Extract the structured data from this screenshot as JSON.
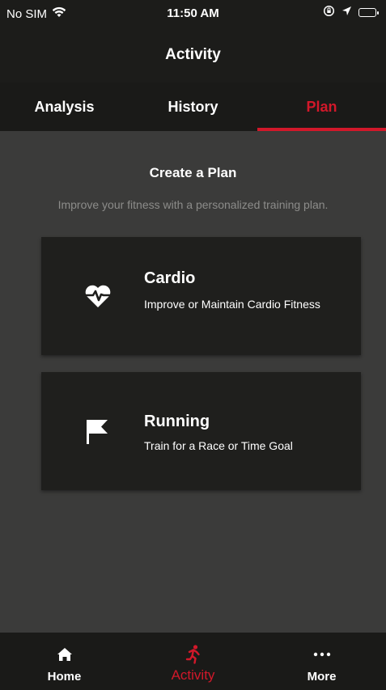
{
  "status_bar": {
    "carrier": "No SIM",
    "time": "11:50 AM"
  },
  "header": {
    "title": "Activity"
  },
  "tabs": [
    {
      "label": "Analysis",
      "active": false
    },
    {
      "label": "History",
      "active": false
    },
    {
      "label": "Plan",
      "active": true
    }
  ],
  "content": {
    "title": "Create a Plan",
    "subtitle": "Improve your fitness with a personalized training plan.",
    "cards": [
      {
        "title": "Cardio",
        "description": "Improve or Maintain Cardio Fitness",
        "icon": "heart-pulse-icon"
      },
      {
        "title": "Running",
        "description": "Train for a Race or Time Goal",
        "icon": "flag-icon"
      }
    ]
  },
  "bottom_nav": [
    {
      "label": "Home",
      "icon": "home-icon",
      "active": false
    },
    {
      "label": "Activity",
      "icon": "runner-icon",
      "active": true
    },
    {
      "label": "More",
      "icon": "more-dots-icon",
      "active": false
    }
  ],
  "colors": {
    "accent": "#d2182a",
    "background": "#3b3b3a",
    "bar": "#1c1c1a",
    "card": "#1f1f1d"
  }
}
